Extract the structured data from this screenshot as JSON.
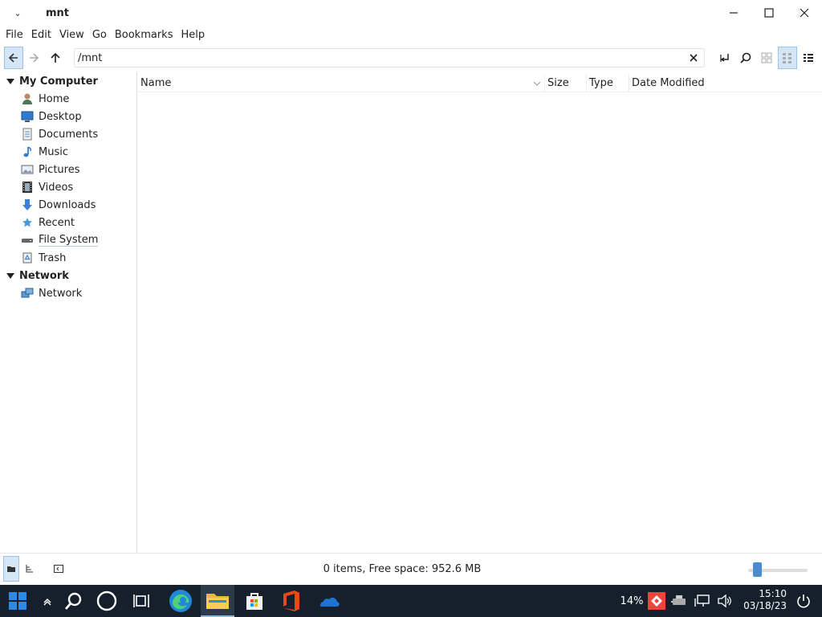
{
  "window": {
    "title": "mnt",
    "menu_glyph": "⌄"
  },
  "menubar": [
    "File",
    "Edit",
    "View",
    "Go",
    "Bookmarks",
    "Help"
  ],
  "toolbar": {
    "location": "/mnt"
  },
  "sidebar": {
    "sections": [
      {
        "label": "My Computer",
        "items": [
          "Home",
          "Desktop",
          "Documents",
          "Music",
          "Pictures",
          "Videos",
          "Downloads",
          "Recent",
          "File System",
          "Trash"
        ]
      },
      {
        "label": "Network",
        "items": [
          "Network"
        ]
      }
    ]
  },
  "list": {
    "columns": [
      "Name",
      "Size",
      "Type",
      "Date Modified"
    ]
  },
  "status": {
    "text": "0 items, Free space: 952.6 MB",
    "zoom_level": 0.15
  },
  "taskbar": {
    "battery": "14%",
    "time": "15:10",
    "date": "03/18/23"
  },
  "colors": {
    "accent": "#4a8ccf",
    "taskbar_bg": "#16202c"
  }
}
